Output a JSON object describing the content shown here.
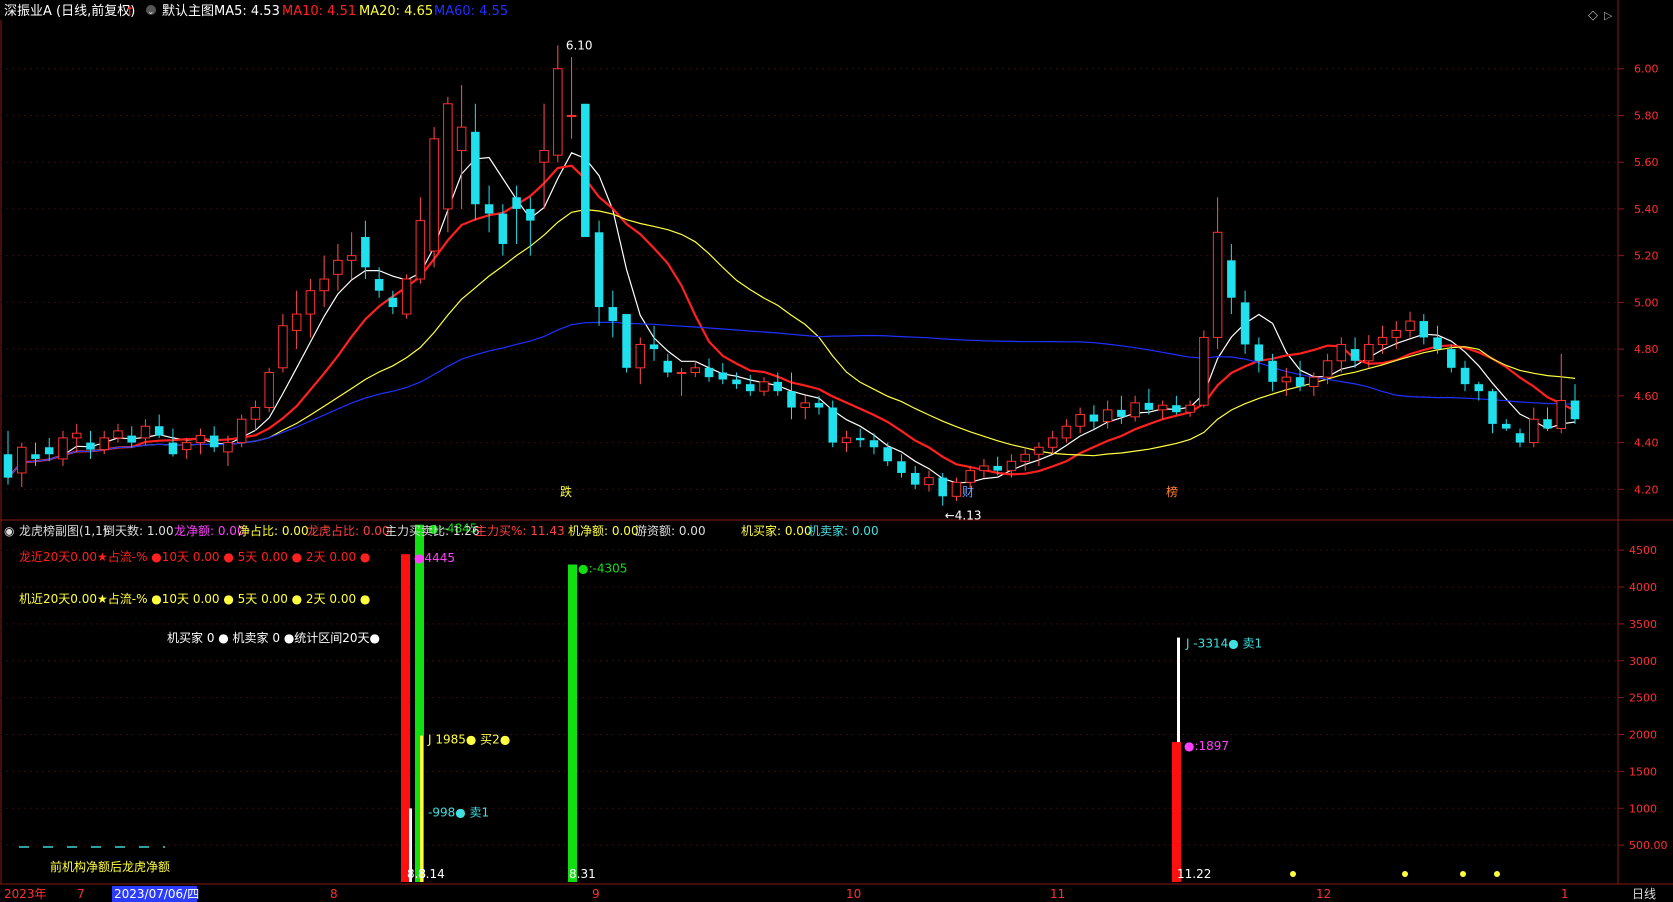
{
  "header": {
    "stock": "深振业A (日线,前复权)",
    "template": "默认主图",
    "ma_labels": [
      {
        "text": "MA5: 4.53",
        "color": "#ffffff"
      },
      {
        "text": "MA10: 4.51",
        "color": "#ff2020"
      },
      {
        "text": "MA20: 4.65",
        "color": "#ffff40"
      },
      {
        "text": "MA60: 4.55",
        "color": "#2030ff"
      }
    ]
  },
  "sub_header": [
    {
      "text": "龙虎榜副图(1,1)",
      "color": "#dddddd"
    },
    {
      "text": "倒天数: 1.00",
      "color": "#dddddd"
    },
    {
      "text": "龙净额: 0.00",
      "color": "#ff40ff"
    },
    {
      "text": "净占比: 0.00",
      "color": "#ffff40"
    },
    {
      "text": "龙虎占比: 0.00",
      "color": "#ff4040"
    },
    {
      "text": "主力买卖比: 1.26",
      "color": "#dddddd"
    },
    {
      "text": "主力买%: 11.43",
      "color": "#ff4040"
    },
    {
      "text": "机净额: 0.00",
      "color": "#ffff40"
    },
    {
      "text": "游资额: 0.00",
      "color": "#dddddd"
    },
    {
      "text": "机买家: 0.00",
      "color": "#ffff40"
    },
    {
      "text": "机卖家: 0.00",
      "color": "#40e0e0"
    }
  ],
  "info_lines": [
    {
      "text": "龙近20天0.00★占流-% ●10天 0.00 ● 5天 0.00 ● 2天 0.00 ●",
      "color": "#ff2020"
    },
    {
      "text": "机近20天0.00★占流-% ●10天 0.00 ● 5天 0.00 ● 2天 0.00 ●",
      "color": "#ffff40"
    },
    {
      "text": "机买家 0 ● 机卖家 0 ●统计区间20天●",
      "color": "#ffffff"
    }
  ],
  "footnote": "前机构净额后龙虎净额",
  "timeline": {
    "labels": [
      "2023年",
      "7",
      "2023/07/06/四",
      "8",
      "9",
      "10",
      "11",
      "12",
      "1"
    ],
    "period": "日线"
  },
  "chart_data": [
    {
      "type": "candlestick",
      "y_ticks": [
        "6.00",
        "5.80",
        "5.60",
        "5.40",
        "5.20",
        "5.00",
        "4.80",
        "4.60",
        "4.40",
        "4.20"
      ],
      "ylim": [
        4.12,
        6.2
      ],
      "annotations": [
        {
          "text": "6.10",
          "note": "high"
        },
        {
          "text": "←4.13",
          "note": "low"
        }
      ],
      "markers": [
        "跌",
        "财",
        "榜"
      ],
      "series": [
        {
          "name": "MA5",
          "color": "#ffffff"
        },
        {
          "name": "MA10",
          "color": "#ff2020"
        },
        {
          "name": "MA20",
          "color": "#ffff40"
        },
        {
          "name": "MA60",
          "color": "#2030ff"
        }
      ],
      "ohlc": [
        [
          4.35,
          4.45,
          4.22,
          4.25
        ],
        [
          4.27,
          4.4,
          4.21,
          4.38
        ],
        [
          4.35,
          4.4,
          4.3,
          4.33
        ],
        [
          4.38,
          4.42,
          4.32,
          4.35
        ],
        [
          4.33,
          4.45,
          4.3,
          4.42
        ],
        [
          4.42,
          4.48,
          4.36,
          4.44
        ],
        [
          4.4,
          4.45,
          4.33,
          4.37
        ],
        [
          4.37,
          4.45,
          4.35,
          4.42
        ],
        [
          4.42,
          4.48,
          4.4,
          4.45
        ],
        [
          4.43,
          4.47,
          4.38,
          4.4
        ],
        [
          4.42,
          4.5,
          4.39,
          4.47
        ],
        [
          4.47,
          4.52,
          4.42,
          4.43
        ],
        [
          4.4,
          4.46,
          4.34,
          4.35
        ],
        [
          4.37,
          4.42,
          4.33,
          4.4
        ],
        [
          4.4,
          4.46,
          4.35,
          4.43
        ],
        [
          4.43,
          4.47,
          4.36,
          4.38
        ],
        [
          4.36,
          4.43,
          4.3,
          4.4
        ],
        [
          4.4,
          4.52,
          4.38,
          4.5
        ],
        [
          4.5,
          4.58,
          4.45,
          4.55
        ],
        [
          4.55,
          4.72,
          4.53,
          4.7
        ],
        [
          4.72,
          4.95,
          4.7,
          4.9
        ],
        [
          4.88,
          5.05,
          4.8,
          4.95
        ],
        [
          4.95,
          5.1,
          4.85,
          5.05
        ],
        [
          5.05,
          5.2,
          4.98,
          5.1
        ],
        [
          5.12,
          5.25,
          5.05,
          5.18
        ],
        [
          5.18,
          5.3,
          5.1,
          5.2
        ],
        [
          5.28,
          5.35,
          5.1,
          5.15
        ],
        [
          5.1,
          5.15,
          5.02,
          5.05
        ],
        [
          5.02,
          5.05,
          4.95,
          4.98
        ],
        [
          4.95,
          5.12,
          4.93,
          5.1
        ],
        [
          5.1,
          5.45,
          5.08,
          5.35
        ],
        [
          5.22,
          5.75,
          5.15,
          5.7
        ],
        [
          5.4,
          5.88,
          5.3,
          5.85
        ],
        [
          5.65,
          5.93,
          5.4,
          5.75
        ],
        [
          5.73,
          5.85,
          5.35,
          5.42
        ],
        [
          5.42,
          5.5,
          5.3,
          5.38
        ],
        [
          5.38,
          5.42,
          5.2,
          5.25
        ],
        [
          5.45,
          5.5,
          5.25,
          5.4
        ],
        [
          5.4,
          5.45,
          5.2,
          5.35
        ],
        [
          5.6,
          5.85,
          5.4,
          5.65
        ],
        [
          5.63,
          6.1,
          5.6,
          6.0
        ],
        [
          5.8,
          6.05,
          5.7,
          5.8
        ],
        [
          5.85,
          5.85,
          5.4,
          5.28
        ],
        [
          5.3,
          5.35,
          4.9,
          4.98
        ],
        [
          4.98,
          5.05,
          4.85,
          4.92
        ],
        [
          4.95,
          4.95,
          4.7,
          4.72
        ],
        [
          4.72,
          4.85,
          4.65,
          4.82
        ],
        [
          4.82,
          4.9,
          4.75,
          4.8
        ],
        [
          4.75,
          4.78,
          4.68,
          4.7
        ],
        [
          4.7,
          4.72,
          4.6,
          4.7
        ],
        [
          4.7,
          4.75,
          4.68,
          4.72
        ],
        [
          4.72,
          4.76,
          4.66,
          4.68
        ],
        [
          4.7,
          4.74,
          4.65,
          4.67
        ],
        [
          4.67,
          4.7,
          4.63,
          4.65
        ],
        [
          4.65,
          4.69,
          4.6,
          4.62
        ],
        [
          4.62,
          4.68,
          4.6,
          4.66
        ],
        [
          4.66,
          4.7,
          4.6,
          4.62
        ],
        [
          4.62,
          4.7,
          4.5,
          4.55
        ],
        [
          4.55,
          4.6,
          4.5,
          4.57
        ],
        [
          4.57,
          4.6,
          4.52,
          4.55
        ],
        [
          4.55,
          4.58,
          4.38,
          4.4
        ],
        [
          4.4,
          4.45,
          4.36,
          4.42
        ],
        [
          4.42,
          4.46,
          4.38,
          4.41
        ],
        [
          4.41,
          4.44,
          4.35,
          4.38
        ],
        [
          4.38,
          4.4,
          4.3,
          4.32
        ],
        [
          4.32,
          4.35,
          4.25,
          4.27
        ],
        [
          4.27,
          4.3,
          4.2,
          4.22
        ],
        [
          4.22,
          4.28,
          4.19,
          4.25
        ],
        [
          4.25,
          4.27,
          4.13,
          4.17
        ],
        [
          4.17,
          4.25,
          4.15,
          4.23
        ],
        [
          4.23,
          4.3,
          4.2,
          4.28
        ],
        [
          4.28,
          4.33,
          4.25,
          4.3
        ],
        [
          4.3,
          4.34,
          4.26,
          4.28
        ],
        [
          4.28,
          4.35,
          4.25,
          4.32
        ],
        [
          4.32,
          4.38,
          4.28,
          4.35
        ],
        [
          4.35,
          4.4,
          4.3,
          4.38
        ],
        [
          4.38,
          4.45,
          4.35,
          4.42
        ],
        [
          4.42,
          4.5,
          4.4,
          4.47
        ],
        [
          4.47,
          4.55,
          4.44,
          4.52
        ],
        [
          4.52,
          4.56,
          4.46,
          4.49
        ],
        [
          4.49,
          4.58,
          4.46,
          4.54
        ],
        [
          4.54,
          4.6,
          4.48,
          4.51
        ],
        [
          4.51,
          4.6,
          4.49,
          4.57
        ],
        [
          4.57,
          4.63,
          4.52,
          4.54
        ],
        [
          4.54,
          4.58,
          4.5,
          4.56
        ],
        [
          4.56,
          4.6,
          4.52,
          4.53
        ],
        [
          4.53,
          4.58,
          4.51,
          4.56
        ],
        [
          4.56,
          4.88,
          4.55,
          4.85
        ],
        [
          4.85,
          5.45,
          4.8,
          5.3
        ],
        [
          5.18,
          5.25,
          4.95,
          5.02
        ],
        [
          5.0,
          5.05,
          4.78,
          4.82
        ],
        [
          4.82,
          4.85,
          4.7,
          4.75
        ],
        [
          4.75,
          4.78,
          4.62,
          4.66
        ],
        [
          4.66,
          4.72,
          4.6,
          4.68
        ],
        [
          4.68,
          4.75,
          4.62,
          4.64
        ],
        [
          4.64,
          4.7,
          4.6,
          4.68
        ],
        [
          4.68,
          4.78,
          4.65,
          4.75
        ],
        [
          4.75,
          4.85,
          4.7,
          4.82
        ],
        [
          4.8,
          4.85,
          4.72,
          4.75
        ],
        [
          4.75,
          4.86,
          4.72,
          4.82
        ],
        [
          4.82,
          4.9,
          4.78,
          4.85
        ],
        [
          4.85,
          4.92,
          4.8,
          4.88
        ],
        [
          4.88,
          4.96,
          4.85,
          4.92
        ],
        [
          4.92,
          4.95,
          4.82,
          4.85
        ],
        [
          4.85,
          4.9,
          4.78,
          4.8
        ],
        [
          4.8,
          4.82,
          4.7,
          4.72
        ],
        [
          4.72,
          4.75,
          4.62,
          4.65
        ],
        [
          4.65,
          4.66,
          4.58,
          4.62
        ],
        [
          4.62,
          4.63,
          4.44,
          4.48
        ],
        [
          4.48,
          4.5,
          4.45,
          4.46
        ],
        [
          4.44,
          4.46,
          4.38,
          4.4
        ],
        [
          4.4,
          4.55,
          4.38,
          4.5
        ],
        [
          4.5,
          4.55,
          4.45,
          4.46
        ],
        [
          4.46,
          4.78,
          4.44,
          4.58
        ],
        [
          4.58,
          4.65,
          4.48,
          4.5
        ]
      ]
    },
    {
      "type": "bar",
      "y_ticks": [
        "4500",
        "4000",
        "3500",
        "3000",
        "2500",
        "2000",
        "1500",
        "1000",
        "500.00"
      ],
      "ylim": [
        0,
        4800
      ],
      "bar_labels": [
        "●:-4845",
        "●4445",
        "J 1985● 买2●",
        "-998● 卖1",
        "●:-4305",
        "J -3314● 卖1",
        "●:1897",
        "8.8",
        "8.14",
        "8.31",
        "11.22"
      ],
      "bars": [
        {
          "name": "8.8 red",
          "value": 4445,
          "color": "#ff1010"
        },
        {
          "name": "8.8 white",
          "value": 998,
          "color": "#ffffff"
        },
        {
          "name": "8.14 green",
          "value": 4845,
          "color": "#10e010"
        },
        {
          "name": "8.14 yellow",
          "value": 1985,
          "color": "#ffff40"
        },
        {
          "name": "8.31 green",
          "value": 4305,
          "color": "#10e010"
        },
        {
          "name": "11.22 white",
          "value": 3314,
          "color": "#ffffff"
        },
        {
          "name": "11.22 red",
          "value": 1897,
          "color": "#ff1010"
        }
      ]
    }
  ]
}
